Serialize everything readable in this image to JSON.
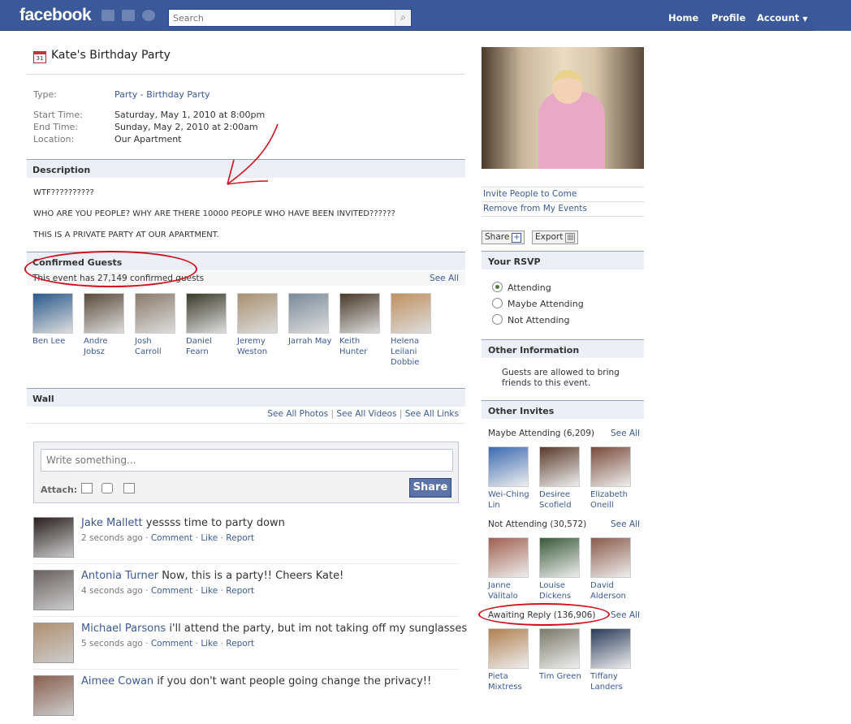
{
  "topbar": {
    "logo": "facebook",
    "search_placeholder": "Search",
    "nav": {
      "home": "Home",
      "profile": "Profile",
      "account": "Account"
    },
    "search_icon": "search-icon",
    "account_arrow_icon": "caret-down-icon"
  },
  "event": {
    "calendar_icon_text": "31",
    "title": "Kate's Birthday Party",
    "type_label": "Type:",
    "type_value": "Party - Birthday Party",
    "start_label": "Start Time:",
    "start_value": "Saturday, May 1, 2010 at 8:00pm",
    "end_label": "End Time:",
    "end_value": "Sunday, May 2, 2010 at 2:00am",
    "location_label": "Location:",
    "location_value": "Our Apartment"
  },
  "description": {
    "heading": "Description",
    "lines": [
      "WTF??????????",
      "WHO ARE YOU PEOPLE? WHY ARE THERE 10000 PEOPLE WHO HAVE BEEN INVITED??????",
      "THIS IS A PRIVATE PARTY AT OUR APARTMENT."
    ]
  },
  "confirmed": {
    "heading": "Confirmed Guests",
    "count_text": "This event has 27,149 confirmed guests",
    "see_all": "See All",
    "guests": [
      {
        "name": "Ben Lee",
        "color": "#2a5a8a"
      },
      {
        "name": "Andre Jobsz",
        "color": "#5a4a3a"
      },
      {
        "name": "Josh Carroll",
        "color": "#8a7a6a"
      },
      {
        "name": "Daniel Fearn",
        "color": "#3a3a2a"
      },
      {
        "name": "Jeremy Weston",
        "color": "#a89070"
      },
      {
        "name": "Jarrah May",
        "color": "#7a8a9a"
      },
      {
        "name": "Keith Hunter",
        "color": "#4a3a2a"
      },
      {
        "name": "Helena Leilani Dobbie",
        "color": "#c09060"
      }
    ]
  },
  "wall": {
    "heading": "Wall",
    "see_photos": "See All Photos",
    "see_videos": "See All Videos",
    "see_links": "See All Links",
    "separator": "|",
    "composer_placeholder": "Write something...",
    "attach_label": "Attach:",
    "share_button": "Share",
    "posts": [
      {
        "author": "Jake Mallett",
        "text": "yessss time to party down",
        "time": "2 seconds ago",
        "color": "#2a2020"
      },
      {
        "author": "Antonia Turner",
        "text": "Now, this is a party!! Cheers Kate!",
        "time": "4 seconds ago",
        "color": "#6a6060"
      },
      {
        "author": "Michael Parsons",
        "text": "i'll attend the party, but im not taking off my sunglasses",
        "time": "5 seconds ago",
        "color": "#b09070"
      },
      {
        "author": "Aimee Cowan",
        "text": "if you don't want people going change the privacy!!",
        "time": "",
        "color": "#8a6050"
      }
    ],
    "actions": {
      "comment": "Comment",
      "like": "Like",
      "report": "Report",
      "dot": "·"
    }
  },
  "sidebar": {
    "invite": "Invite People to Come",
    "remove": "Remove from My Events",
    "share": "Share",
    "export": "Export",
    "rsvp_heading": "Your RSVP",
    "rsvp_options": [
      "Attending",
      "Maybe Attending",
      "Not Attending"
    ],
    "rsvp_selected": "Attending",
    "other_info_heading": "Other Information",
    "other_info_text": "Guests are allowed to bring friends to this event.",
    "other_invites_heading": "Other Invites",
    "maybe_label": "Maybe Attending (6,209)",
    "maybe_see_all": "See All",
    "maybe_people": [
      {
        "name": "Wei-Ching Lin",
        "color": "#3a6ab0"
      },
      {
        "name": "Desiree Scofield",
        "color": "#5a3a2a"
      },
      {
        "name": "Elizabeth Oneill",
        "color": "#7a4a3a"
      }
    ],
    "not_label": "Not Attending (30,572)",
    "not_see_all": "See All",
    "not_people": [
      {
        "name": "Janne Välitalo",
        "color": "#a06050"
      },
      {
        "name": "Louise Dickens",
        "color": "#3a5a3a"
      },
      {
        "name": "David Alderson",
        "color": "#8a5a4a"
      }
    ],
    "awaiting_label": "Awaiting Reply (136,906)",
    "awaiting_see_all": "See All",
    "awaiting_people": [
      {
        "name": "Pieta Mixtress",
        "color": "#b08050"
      },
      {
        "name": "Tim Green",
        "color": "#7a7a6a"
      },
      {
        "name": "Tiffany Landers",
        "color": "#2a3a5a"
      }
    ]
  },
  "annotation_color": "#d0101a"
}
